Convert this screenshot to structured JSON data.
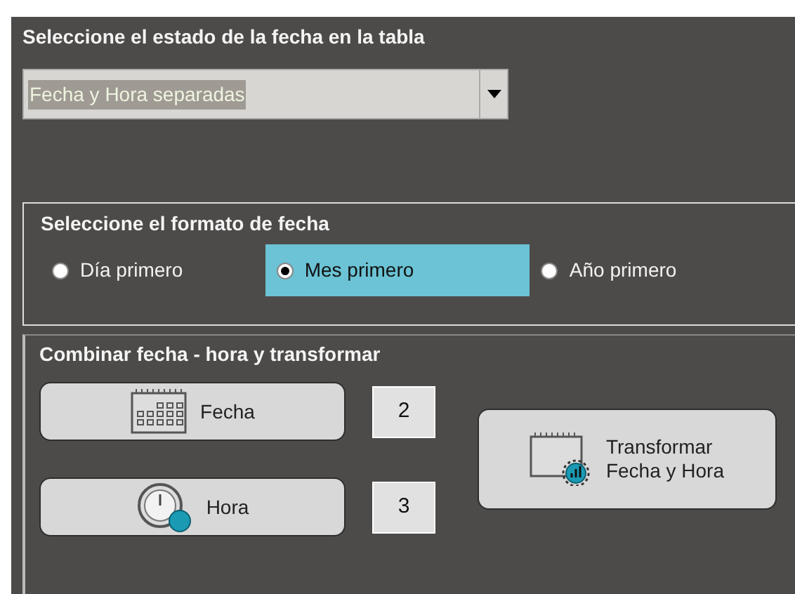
{
  "table_state": {
    "heading": "Seleccione el estado de la fecha en la tabla",
    "select": {
      "value": "Fecha y Hora separadas"
    }
  },
  "date_format": {
    "heading": "Seleccione el formato de fecha",
    "options": [
      {
        "label": "Día primero",
        "selected": false
      },
      {
        "label": "Mes primero",
        "selected": true
      },
      {
        "label": "Año primero",
        "selected": false
      }
    ]
  },
  "combine": {
    "heading": "Combinar fecha - hora y transformar",
    "rows": [
      {
        "kind": "date",
        "label": "Fecha",
        "value": "2"
      },
      {
        "kind": "time",
        "label": "Hora",
        "value": "3"
      }
    ],
    "transform_button": [
      "Transformar",
      "Fecha y Hora"
    ]
  }
}
